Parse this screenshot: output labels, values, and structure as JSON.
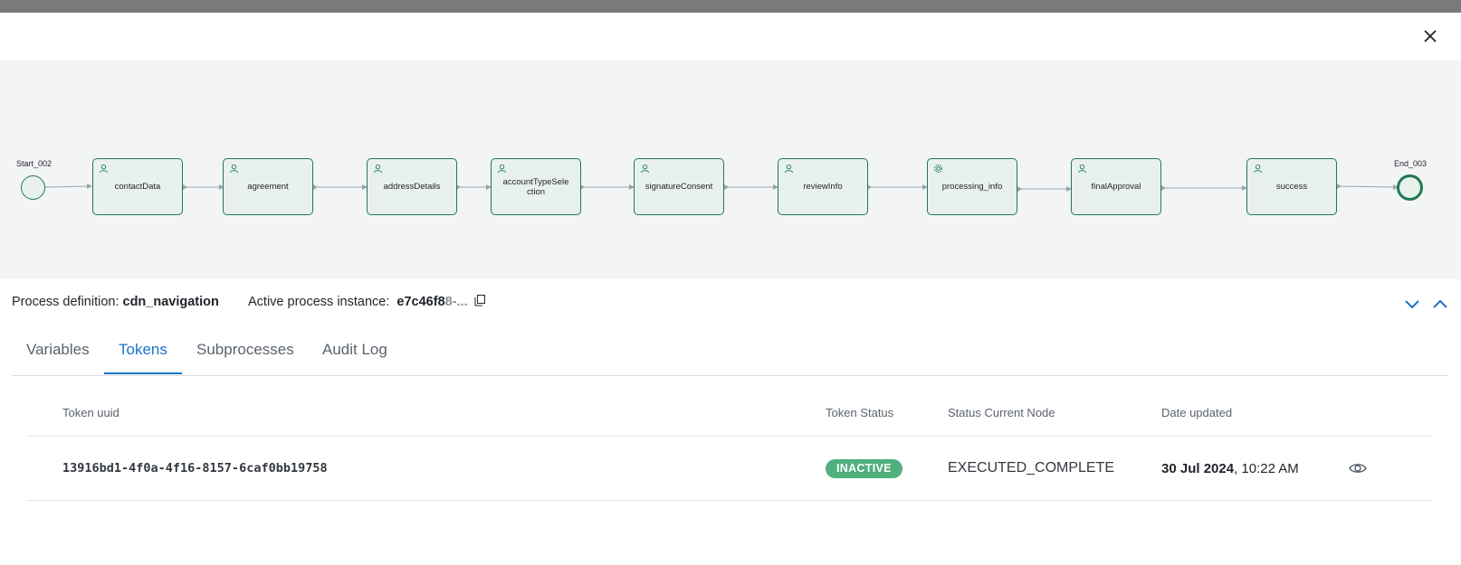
{
  "header": {
    "close_icon": "close-icon"
  },
  "diagram": {
    "start_label": "Start_002",
    "end_label": "End_003",
    "nodes": [
      {
        "label": "contactData",
        "icon": "user-icon"
      },
      {
        "label": "agreement",
        "icon": "user-icon"
      },
      {
        "label": "addressDetails",
        "icon": "user-icon"
      },
      {
        "label": "accountTypeSelection",
        "icon": "user-icon"
      },
      {
        "label": "signatureConsent",
        "icon": "user-icon"
      },
      {
        "label": "reviewInfo",
        "icon": "user-icon"
      },
      {
        "label": "processing_info",
        "icon": "gear-icon"
      },
      {
        "label": "finalApproval",
        "icon": "user-icon"
      },
      {
        "label": "success",
        "icon": "user-icon"
      }
    ]
  },
  "info": {
    "definition_label": "Process definition:",
    "definition_value": "cdn_navigation",
    "instance_label": "Active process instance:",
    "instance_value": "e7c46f8",
    "instance_fade": "8-..."
  },
  "tabs": [
    {
      "label": "Variables",
      "active": false
    },
    {
      "label": "Tokens",
      "active": true
    },
    {
      "label": "Subprocesses",
      "active": false
    },
    {
      "label": "Audit Log",
      "active": false
    }
  ],
  "table": {
    "headers": [
      "Token uuid",
      "Token Status",
      "Status Current Node",
      "Date updated"
    ],
    "rows": [
      {
        "uuid": "13916bd1-4f0a-4f16-8157-6caf0bb19758",
        "status": "INACTIVE",
        "current_node": "EXECUTED_COMPLETE",
        "date_bold": "30 Jul 2024",
        "time": ", 10:22 AM"
      }
    ]
  },
  "colors": {
    "accent": "#1a73c8",
    "node_border": "#1f7a53",
    "badge": "#4fb07c"
  }
}
